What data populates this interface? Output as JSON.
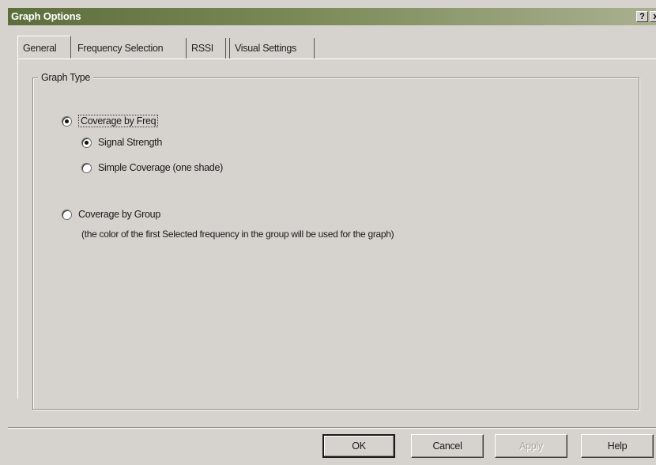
{
  "window": {
    "title": "Graph Options",
    "help_glyph": "?",
    "close_glyph": "x"
  },
  "tabs": [
    {
      "label": "General",
      "active": true
    },
    {
      "label": "Frequency Selection",
      "active": false
    },
    {
      "label": "RSSI",
      "active": false
    },
    {
      "label": "Visual Settings",
      "active": false
    }
  ],
  "graph_type": {
    "legend": "Graph Type",
    "options": [
      {
        "label": "Coverage by Freq",
        "checked": true
      },
      {
        "label": "Signal Strength",
        "checked": true
      },
      {
        "label": "Simple Coverage (one shade)",
        "checked": false
      },
      {
        "label": "Coverage by Group",
        "checked": false
      }
    ],
    "group_hint": "(the color of the first Selected frequency in the group will be used for the graph)"
  },
  "buttons": {
    "ok": "OK",
    "cancel": "Cancel",
    "apply": "Apply",
    "help": "Help"
  }
}
